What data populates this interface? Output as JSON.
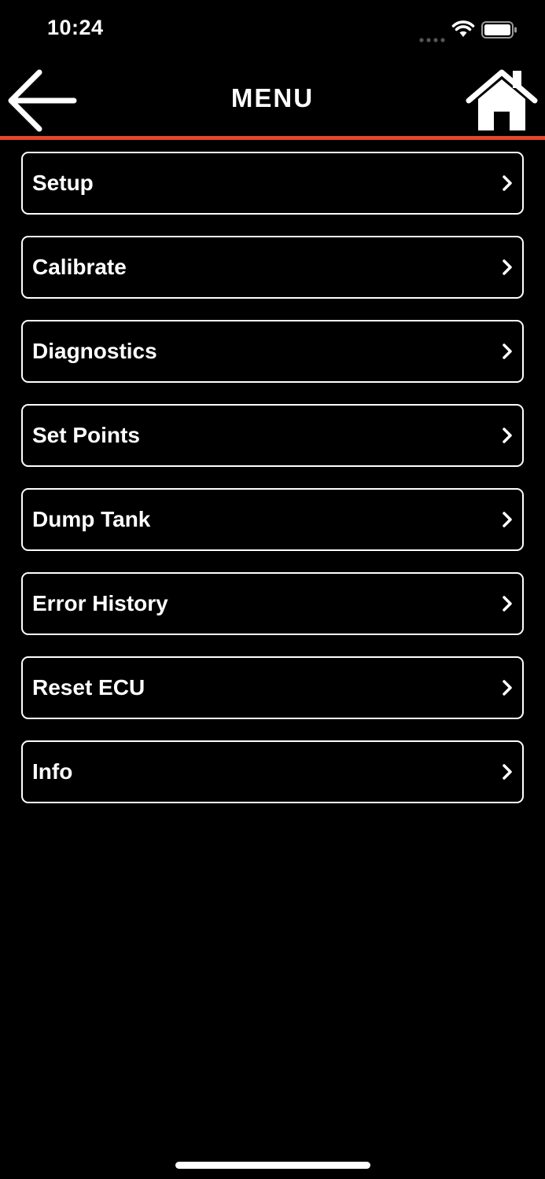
{
  "status_bar": {
    "time": "10:24"
  },
  "nav": {
    "title": "MENU",
    "back_icon": "arrow-left-icon",
    "home_icon": "home-icon"
  },
  "menu": {
    "items": [
      {
        "label": "Setup"
      },
      {
        "label": "Calibrate"
      },
      {
        "label": "Diagnostics"
      },
      {
        "label": "Set Points"
      },
      {
        "label": "Dump Tank"
      },
      {
        "label": "Error History"
      },
      {
        "label": "Reset ECU"
      },
      {
        "label": "Info"
      }
    ],
    "chevron_icon": "chevron-right-icon"
  },
  "colors": {
    "background": "#000000",
    "accent": "#e1472f",
    "foreground": "#ffffff"
  }
}
